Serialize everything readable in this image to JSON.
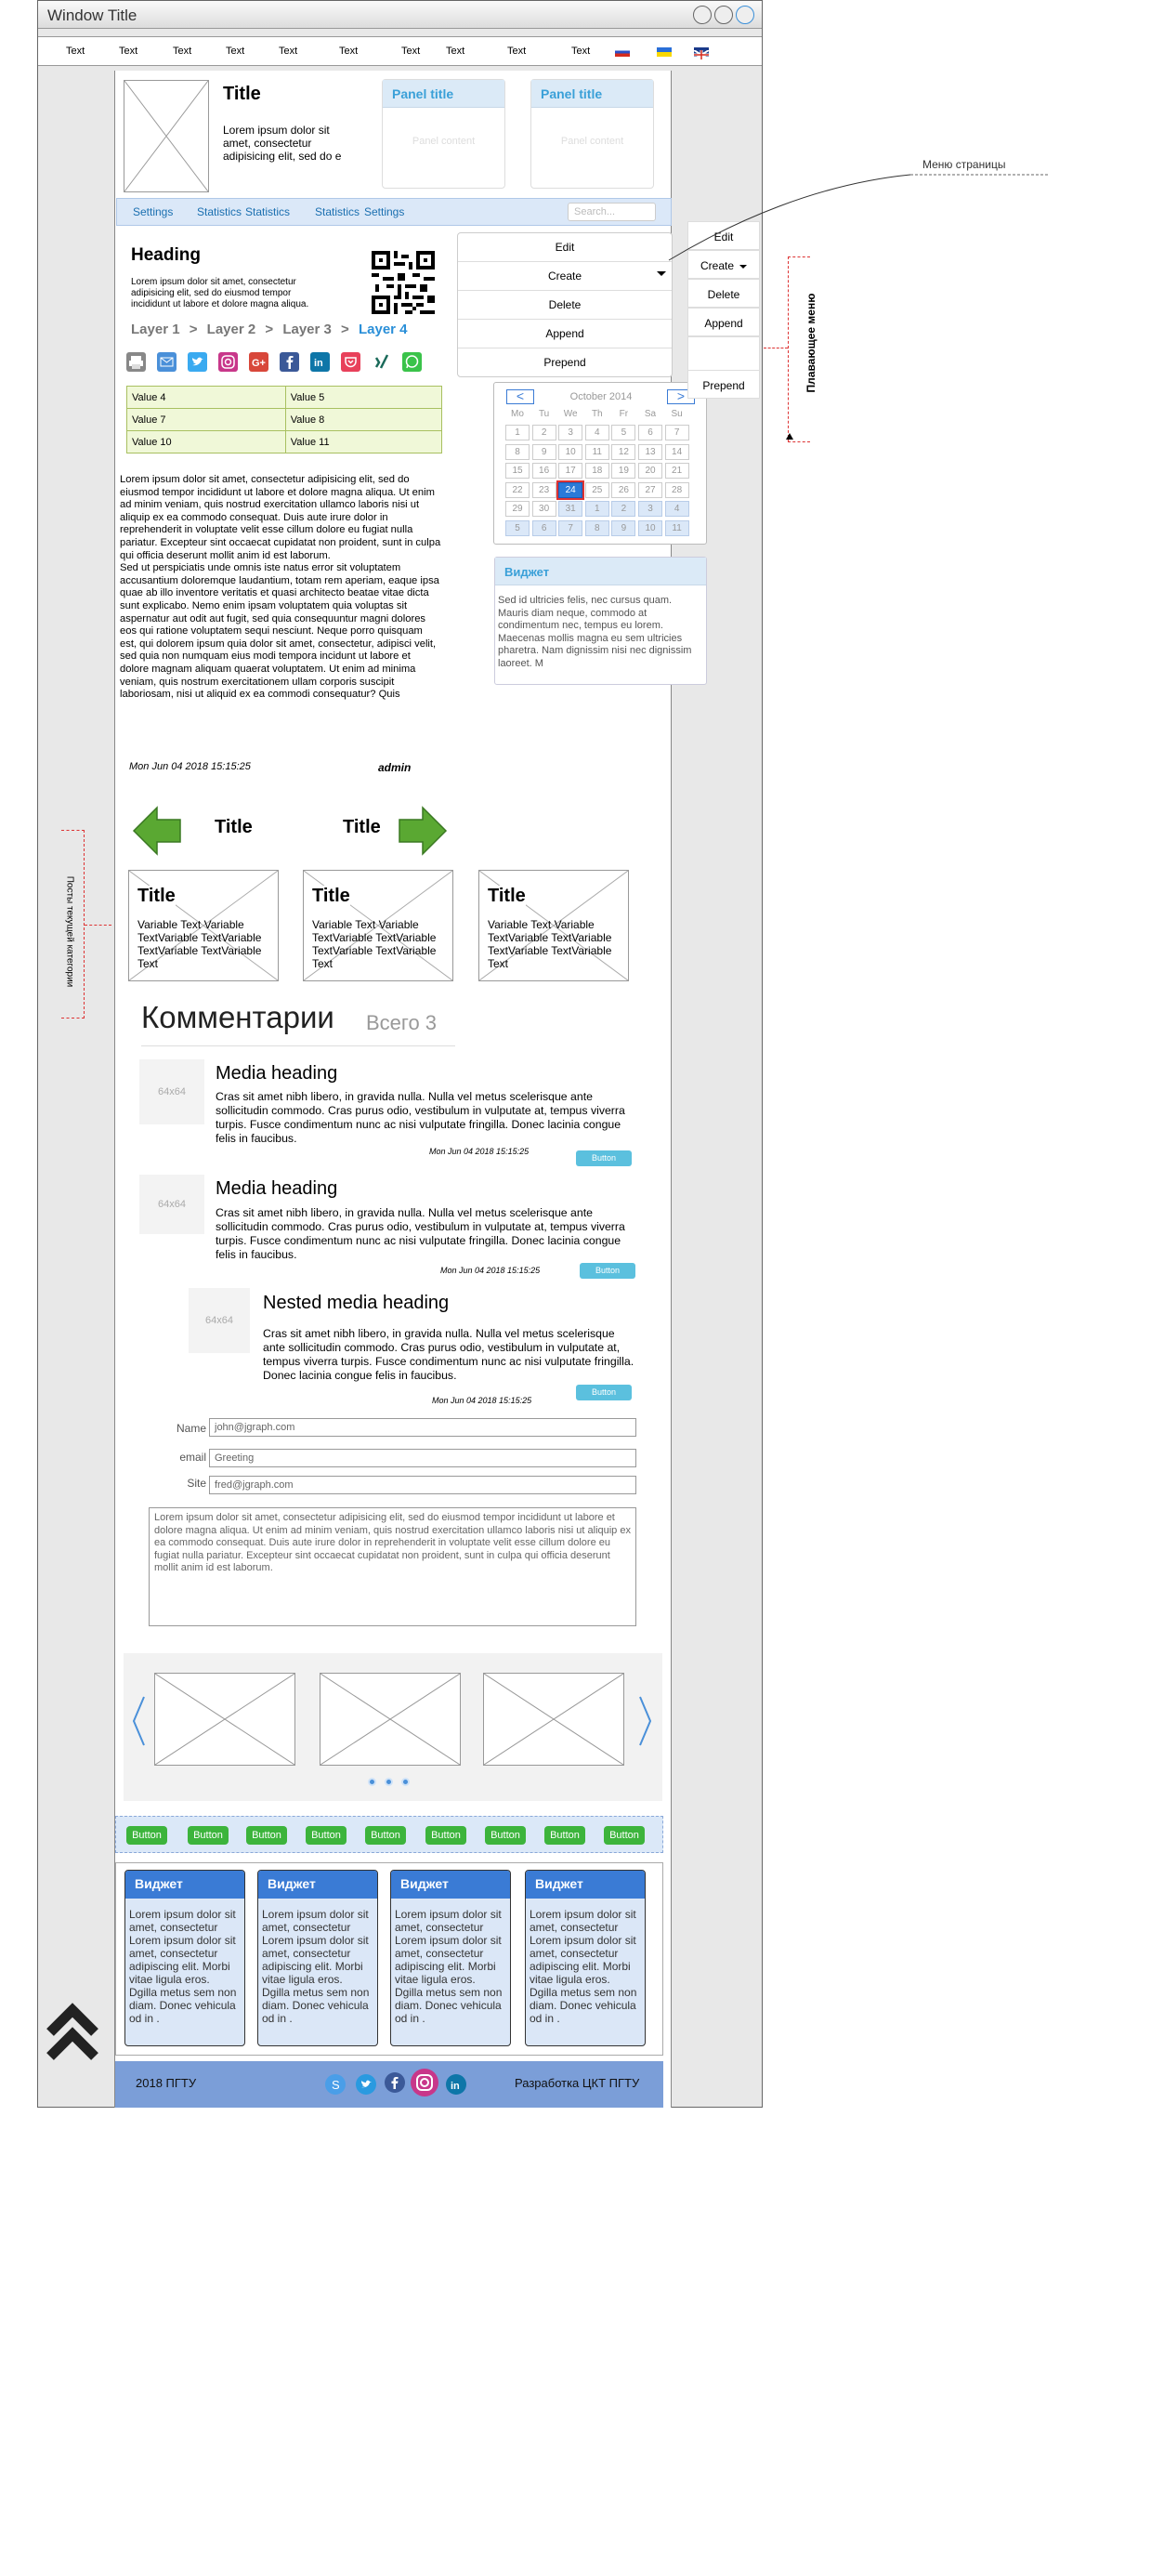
{
  "window": {
    "title": "Window Title"
  },
  "menu": {
    "items": [
      "Text",
      "Text",
      "Text",
      "Text",
      "Text",
      "Text",
      "Text",
      "Text",
      "Text",
      "Text"
    ]
  },
  "header": {
    "title": "Title",
    "text": "Lorem ipsum dolor sit amet, consectetur adipisicing elit, sed do e",
    "panels": [
      {
        "title": "Panel title",
        "content": "Panel content"
      },
      {
        "title": "Panel title",
        "content": "Panel content"
      }
    ]
  },
  "nav": {
    "items": [
      "Settings",
      "Statistics",
      "Statistics",
      "Statistics",
      "Settings"
    ],
    "search_placeholder": "Search..."
  },
  "article": {
    "heading": "Heading",
    "intro": "Lorem ipsum dolor sit amet, consectetur adipisicing elit, sed do eiusmod tempor incididunt ut labore et dolore magna aliqua.",
    "breadcrumb": [
      "Layer 1",
      "Layer 2",
      "Layer 3",
      "Layer 4"
    ],
    "table": [
      [
        "Value 4",
        "Value 5"
      ],
      [
        "Value 7",
        "Value 8"
      ],
      [
        "Value 10",
        "Value 11"
      ]
    ],
    "body": "Lorem ipsum dolor sit amet, consectetur adipisicing elit, sed do eiusmod tempor incididunt ut labore et dolore magna aliqua. Ut enim ad minim veniam, quis nostrud exercitation ullamco laboris nisi ut aliquip ex ea commodo consequat. Duis aute irure dolor in reprehenderit in voluptate velit esse cillum dolore eu fugiat nulla pariatur. Excepteur sint occaecat cupidatat non proident, sunt in culpa qui officia deserunt mollit anim id est laborum.\nSed ut perspiciatis unde omnis iste natus error sit voluptatem accusantium doloremque laudantium, totam rem aperiam, eaque ipsa quae ab illo inventore veritatis et quasi architecto beatae vitae dicta sunt explicabo. Nemo enim ipsam voluptatem quia voluptas sit aspernatur aut odit aut fugit, sed quia consequuntur magni dolores eos qui ratione voluptatem sequi nesciunt. Neque porro quisquam est, qui dolorem ipsum quia dolor sit amet, consectetur, adipisci velit, sed quia non numquam eius modi tempora incidunt ut labore et dolore magnam aliquam quaerat voluptatem. Ut enim ad minima veniam, quis nostrum exercitationem ullam corporis suscipit laboriosam, nisi ut aliquid ex ea commodi consequatur? Quis",
    "date": "Mon Jun 04 2018 15:15:25",
    "author": "admin"
  },
  "actions": [
    "Edit",
    "Create",
    "Delete",
    "Append",
    "Prepend"
  ],
  "calendar": {
    "month": "October 2014",
    "prev": "<",
    "next": ">",
    "days": [
      "Mo",
      "Tu",
      "We",
      "Th",
      "Fr",
      "Sa",
      "Su"
    ],
    "cells": [
      "1",
      "2",
      "3",
      "4",
      "5",
      "6",
      "7",
      "8",
      "9",
      "10",
      "11",
      "12",
      "13",
      "14",
      "15",
      "16",
      "17",
      "18",
      "19",
      "20",
      "21",
      "22",
      "23",
      "24",
      "25",
      "26",
      "27",
      "28",
      "29",
      "30",
      "31",
      "1",
      "2",
      "3",
      "4",
      "5",
      "6",
      "7",
      "8",
      "9",
      "10",
      "11"
    ],
    "selected": "24"
  },
  "side_widget": {
    "title": "Виджет",
    "text": "Sed id ultricies felis, nec cursus quam. Mauris diam neque, commodo at condimentum nec, tempus eu lorem. Maecenas mollis magna eu sem ultricies pharetra. Nam dignissim nisi nec dignissim laoreet. M"
  },
  "posts": {
    "titles": [
      "Title",
      "Title"
    ],
    "cards": [
      {
        "title": "Title",
        "text": "Variable Text Variable TextVariable TextVariable TextVariable TextVariable Text"
      },
      {
        "title": "Title",
        "text": "Variable Text Variable TextVariable TextVariable TextVariable TextVariable Text"
      },
      {
        "title": "Title",
        "text": "Variable Text Variable TextVariable TextVariable TextVariable TextVariable Text"
      }
    ]
  },
  "comments": {
    "title": "Комментарии",
    "count": "Всего 3",
    "items": [
      {
        "avatar": "64x64",
        "heading": "Media heading",
        "text": "Cras sit amet nibh libero, in gravida nulla. Nulla vel metus scelerisque ante sollicitudin commodo. Cras purus odio, vestibulum in vulputate at, tempus viverra turpis. Fusce condimentum nunc ac nisi vulputate fringilla. Donec lacinia congue felis in faucibus.",
        "date": "Mon Jun 04 2018 15:15:25",
        "button": "Button"
      },
      {
        "avatar": "64x64",
        "heading": "Media heading",
        "text": "Cras sit amet nibh libero, in gravida nulla. Nulla vel metus scelerisque ante sollicitudin commodo. Cras purus odio, vestibulum in vulputate at, tempus viverra turpis. Fusce condimentum nunc ac nisi vulputate fringilla. Donec lacinia congue felis in faucibus.",
        "date": "Mon Jun 04 2018 15:15:25",
        "button": "Button"
      },
      {
        "avatar": "64x64",
        "heading": "Nested media heading",
        "text": "Cras sit amet nibh libero, in gravida nulla. Nulla vel metus scelerisque ante sollicitudin commodo. Cras purus odio, vestibulum in vulputate at, tempus viverra turpis. Fusce condimentum nunc ac nisi vulputate fringilla. Donec lacinia congue felis in faucibus.",
        "date": "Mon Jun 04 2018 15:15:25",
        "button": "Button"
      }
    ]
  },
  "form": {
    "name_label": "Name",
    "name_value": "john@jgraph.com",
    "email_label": "email",
    "email_placeholder": "Greeting",
    "site_label": "Site",
    "site_value": "fred@jgraph.com",
    "message": "Lorem ipsum dolor sit amet, consectetur adipisicing elit, sed do eiusmod tempor incididunt ut labore et dolore magna aliqua. Ut enim ad minim veniam, quis nostrud exercitation ullamco laboris nisi ut aliquip ex ea commodo consequat. Duis aute irure dolor in reprehenderit in voluptate velit esse cillum dolore eu fugiat nulla pariatur. Excepteur sint occaecat cupidatat non proident, sunt in culpa qui officia deserunt mollit anim id est laborum."
  },
  "button_row": [
    "Button",
    "Button",
    "Button",
    "Button",
    "Button",
    "Button",
    "Button",
    "Button",
    "Button"
  ],
  "widgets": [
    {
      "title": "Виджет",
      "text": "Lorem ipsum dolor sit amet, consectetur Lorem ipsum dolor sit amet, consectetur adipiscing elit. Morbi vitae ligula eros. Dgilla metus sem non diam. Donec vehicula od in ."
    },
    {
      "title": "Виджет",
      "text": "Lorem ipsum dolor sit amet, consectetur Lorem ipsum dolor sit amet, consectetur adipiscing elit. Morbi vitae ligula eros. Dgilla metus sem non diam. Donec vehicula od in ."
    },
    {
      "title": "Виджет",
      "text": "Lorem ipsum dolor sit amet, consectetur Lorem ipsum dolor sit amet, consectetur adipiscing elit. Morbi vitae ligula eros. Dgilla metus sem non diam. Donec vehicula od in ."
    },
    {
      "title": "Виджет",
      "text": "Lorem ipsum dolor sit amet, consectetur Lorem ipsum dolor sit amet, consectetur adipiscing elit. Morbi vitae ligula eros. Dgilla metus sem non diam. Donec vehicula od in ."
    }
  ],
  "footer": {
    "left": "2018 ПГТУ",
    "right": "Разработка ЦКТ ПГТУ"
  },
  "annotations": {
    "page_menu": "Меню страницы",
    "floating_menu": "Плавающее меню",
    "category_posts": "Посты текущей категории"
  },
  "floating": [
    "Edit",
    "Create",
    "Delete",
    "Append",
    "Prepend"
  ],
  "colors": {
    "accent": "#3aa0d8",
    "nav_bg": "#dbe8f8",
    "footer_bg": "#7b9ed8",
    "green": "#3cb43c"
  }
}
